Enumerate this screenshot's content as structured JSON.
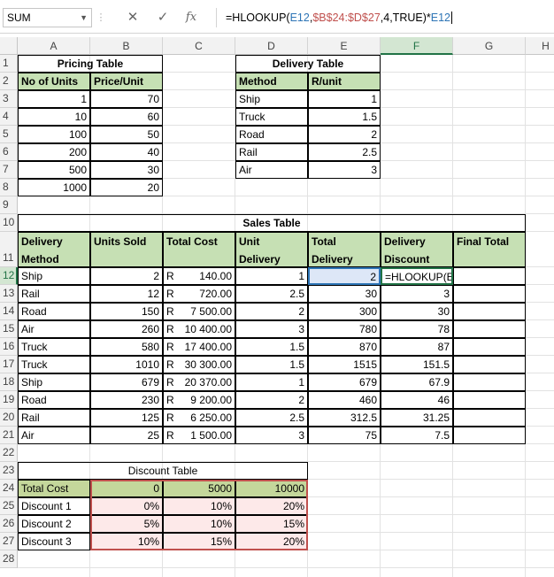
{
  "name_box": "SUM",
  "formula_bar": {
    "prefix": "=HLOOKUP(",
    "ref1": "E12",
    "sep1": ",",
    "ref2": "$B$24:$D$27",
    "suffix": ",4,TRUE)*",
    "ref3": "E12"
  },
  "columns": [
    "A",
    "B",
    "C",
    "D",
    "E",
    "F",
    "G",
    "H"
  ],
  "rows": [
    "1",
    "2",
    "3",
    "4",
    "5",
    "6",
    "7",
    "8",
    "9",
    "10",
    "11",
    "12",
    "13",
    "14",
    "15",
    "16",
    "17",
    "18",
    "19",
    "20",
    "21",
    "22",
    "23",
    "24",
    "25",
    "26",
    "27",
    "28"
  ],
  "pricing": {
    "title": "Pricing Table",
    "headers": [
      "No of Units",
      "Price/Unit"
    ],
    "rows": [
      [
        "1",
        "70"
      ],
      [
        "10",
        "60"
      ],
      [
        "100",
        "50"
      ],
      [
        "200",
        "40"
      ],
      [
        "500",
        "30"
      ],
      [
        "1000",
        "20"
      ]
    ]
  },
  "delivery": {
    "title": "Delivery Table",
    "headers": [
      "Method",
      "R/unit"
    ],
    "rows": [
      [
        "Ship",
        "1"
      ],
      [
        "Truck",
        "1.5"
      ],
      [
        "Road",
        "2"
      ],
      [
        "Rail",
        "2.5"
      ],
      [
        "Air",
        "3"
      ]
    ]
  },
  "sales": {
    "title": "Sales Table",
    "headers": [
      [
        "Delivery",
        "Method"
      ],
      [
        "",
        "Units Sold"
      ],
      [
        "",
        "Total Cost"
      ],
      [
        "Unit",
        "Delivery"
      ],
      [
        "Total",
        "Delivery"
      ],
      [
        "Delivery",
        "Discount"
      ],
      [
        "",
        "Final Total"
      ]
    ],
    "rows": [
      [
        "Ship",
        "2",
        "R",
        "140.00",
        "1",
        "2",
        "=HLOOKUP(E"
      ],
      [
        "Rail",
        "12",
        "R",
        "720.00",
        "2.5",
        "30",
        "3"
      ],
      [
        "Road",
        "150",
        "R",
        "7 500.00",
        "2",
        "300",
        "30"
      ],
      [
        "Air",
        "260",
        "R",
        "10 400.00",
        "3",
        "780",
        "78"
      ],
      [
        "Truck",
        "580",
        "R",
        "17 400.00",
        "1.5",
        "870",
        "87"
      ],
      [
        "Truck",
        "1010",
        "R",
        "30 300.00",
        "1.5",
        "1515",
        "151.5"
      ],
      [
        "Ship",
        "679",
        "R",
        "20 370.00",
        "1",
        "679",
        "67.9"
      ],
      [
        "Road",
        "230",
        "R",
        "9 200.00",
        "2",
        "460",
        "46"
      ],
      [
        "Rail",
        "125",
        "R",
        "6 250.00",
        "2.5",
        "312.5",
        "31.25"
      ],
      [
        "Air",
        "25",
        "R",
        "1 500.00",
        "3",
        "75",
        "7.5"
      ]
    ]
  },
  "discount": {
    "title": "Discount Table",
    "rows": [
      [
        "Total Cost",
        "0",
        "5000",
        "10000"
      ],
      [
        "Discount 1",
        "0%",
        "10%",
        "20%"
      ],
      [
        "Discount 2",
        "5%",
        "10%",
        "15%"
      ],
      [
        "Discount 3",
        "10%",
        "15%",
        "20%"
      ]
    ]
  }
}
